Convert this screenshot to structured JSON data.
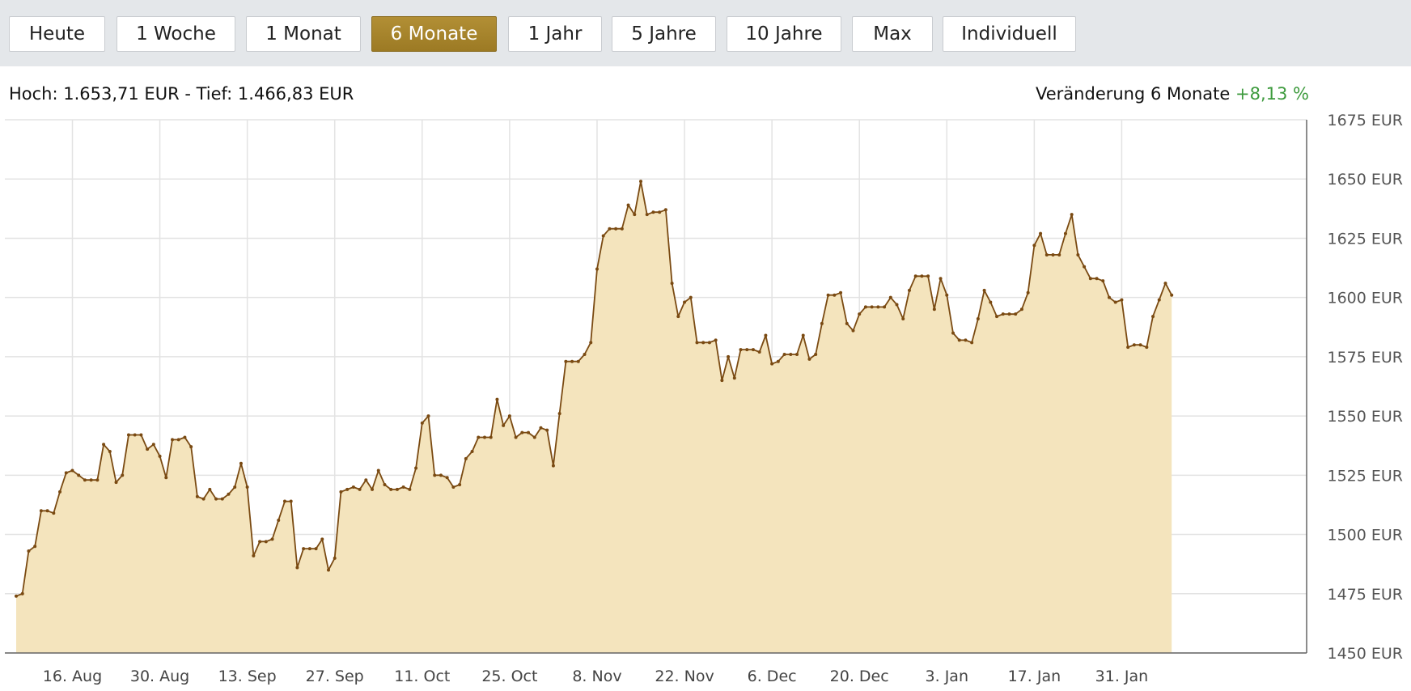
{
  "toolbar": {
    "buttons": [
      {
        "label": "Heute",
        "active": false
      },
      {
        "label": "1 Woche",
        "active": false
      },
      {
        "label": "1 Monat",
        "active": false
      },
      {
        "label": "6 Monate",
        "active": true
      },
      {
        "label": "1 Jahr",
        "active": false
      },
      {
        "label": "5 Jahre",
        "active": false
      },
      {
        "label": "10 Jahre",
        "active": false
      },
      {
        "label": "Max",
        "active": false
      },
      {
        "label": "Individuell",
        "active": false
      }
    ]
  },
  "info": {
    "range_text": "Hoch: 1.653,71 EUR - Tief: 1.466,83 EUR",
    "change_label": "Veränderung 6 Monate",
    "change_value": "+8,13 %"
  },
  "colors": {
    "active_button": "#a8852d",
    "line": "#7a4a12",
    "area": "#f4e4bd",
    "grid": "#e3e3e3",
    "change_positive": "#3c9a3c"
  },
  "chart_data": {
    "type": "area",
    "ylim": [
      1450,
      1675
    ],
    "yticks": [
      1450,
      1475,
      1500,
      1525,
      1550,
      1575,
      1600,
      1625,
      1650,
      1675
    ],
    "ytick_labels": [
      "1450 EUR",
      "1475 EUR",
      "1500 EUR",
      "1525 EUR",
      "1550 EUR",
      "1575 EUR",
      "1600 EUR",
      "1625 EUR",
      "1650 EUR",
      "1675 EUR"
    ],
    "xticks": [
      {
        "label": "16. Aug",
        "day": 9
      },
      {
        "label": "30. Aug",
        "day": 23
      },
      {
        "label": "13. Sep",
        "day": 37
      },
      {
        "label": "27. Sep",
        "day": 51
      },
      {
        "label": "11. Oct",
        "day": 65
      },
      {
        "label": "25. Oct",
        "day": 79
      },
      {
        "label": "8. Nov",
        "day": 93
      },
      {
        "label": "22. Nov",
        "day": 107
      },
      {
        "label": "6. Dec",
        "day": 121
      },
      {
        "label": "20. Dec",
        "day": 135
      },
      {
        "label": "3. Jan",
        "day": 149
      },
      {
        "label": "17. Jan",
        "day": 163
      },
      {
        "label": "31. Jan",
        "day": 177
      }
    ],
    "x": [
      0,
      1,
      2,
      3,
      4,
      5,
      6,
      7,
      8,
      9,
      10,
      11,
      12,
      13,
      14,
      15,
      16,
      17,
      18,
      19,
      20,
      21,
      22,
      23,
      24,
      25,
      26,
      27,
      28,
      29,
      30,
      31,
      32,
      33,
      34,
      35,
      36,
      37,
      38,
      39,
      40,
      41,
      42,
      43,
      44,
      45,
      46,
      47,
      48,
      49,
      50,
      51,
      52,
      53,
      54,
      55,
      56,
      57,
      58,
      59,
      60,
      61,
      62,
      63,
      64,
      65,
      66,
      67,
      68,
      69,
      70,
      71,
      72,
      73,
      74,
      75,
      76,
      77,
      78,
      79,
      80,
      81,
      82,
      83,
      84,
      85,
      86,
      87,
      88,
      89,
      90,
      91,
      92,
      93,
      94,
      95,
      96,
      97,
      98,
      99,
      100,
      101,
      102,
      103,
      104,
      105,
      106,
      107,
      108,
      109,
      110,
      111,
      112,
      113,
      114,
      115,
      116,
      117,
      118,
      119,
      120,
      121,
      122,
      123,
      124,
      125,
      126,
      127,
      128,
      129,
      130,
      131,
      132,
      133,
      134,
      135,
      136,
      137,
      138,
      139,
      140,
      141,
      142,
      143,
      144,
      145,
      146,
      147,
      148,
      149,
      150,
      151,
      152,
      153,
      154,
      155,
      156,
      157,
      158,
      159,
      160,
      161,
      162,
      163,
      164,
      165,
      166,
      167,
      168,
      169,
      170,
      171,
      172,
      173,
      174,
      175,
      176,
      177,
      178,
      179,
      180,
      181,
      182,
      183,
      184,
      185
    ],
    "values": [
      1474,
      1475,
      1493,
      1495,
      1510,
      1510,
      1509,
      1518,
      1526,
      1527,
      1525,
      1523,
      1523,
      1523,
      1538,
      1535,
      1522,
      1525,
      1542,
      1542,
      1542,
      1536,
      1538,
      1533,
      1524,
      1540,
      1540,
      1541,
      1537,
      1516,
      1515,
      1519,
      1515,
      1515,
      1517,
      1520,
      1530,
      1520,
      1491,
      1497,
      1497,
      1498,
      1506,
      1514,
      1514,
      1486,
      1494,
      1494,
      1494,
      1498,
      1485,
      1490,
      1518,
      1519,
      1520,
      1519,
      1523,
      1519,
      1527,
      1521,
      1519,
      1519,
      1520,
      1519,
      1528,
      1547,
      1550,
      1525,
      1525,
      1524,
      1520,
      1521,
      1532,
      1535,
      1541,
      1541,
      1541,
      1557,
      1546,
      1550,
      1541,
      1543,
      1543,
      1541,
      1545,
      1544,
      1529,
      1551,
      1573,
      1573,
      1573,
      1576,
      1581,
      1612,
      1626,
      1629,
      1629,
      1629,
      1639,
      1635,
      1649,
      1635,
      1636,
      1636,
      1637,
      1606,
      1592,
      1598,
      1600,
      1581,
      1581,
      1581,
      1582,
      1565,
      1575,
      1566,
      1578,
      1578,
      1578,
      1577,
      1584,
      1572,
      1573,
      1576,
      1576,
      1576,
      1584,
      1574,
      1576,
      1589,
      1601,
      1601,
      1602,
      1589,
      1586,
      1593,
      1596,
      1596,
      1596,
      1596,
      1600,
      1597,
      1591,
      1603,
      1609,
      1609,
      1609,
      1595,
      1608,
      1601,
      1585,
      1582,
      1582,
      1581,
      1591,
      1603,
      1598,
      1592,
      1593,
      1593,
      1593,
      1595,
      1602,
      1622,
      1627,
      1618,
      1618,
      1618,
      1627,
      1635,
      1618,
      1613,
      1608,
      1608,
      1607,
      1600,
      1598,
      1599,
      1579,
      1580,
      1580,
      1579,
      1592,
      1599,
      1606,
      1601
    ]
  }
}
